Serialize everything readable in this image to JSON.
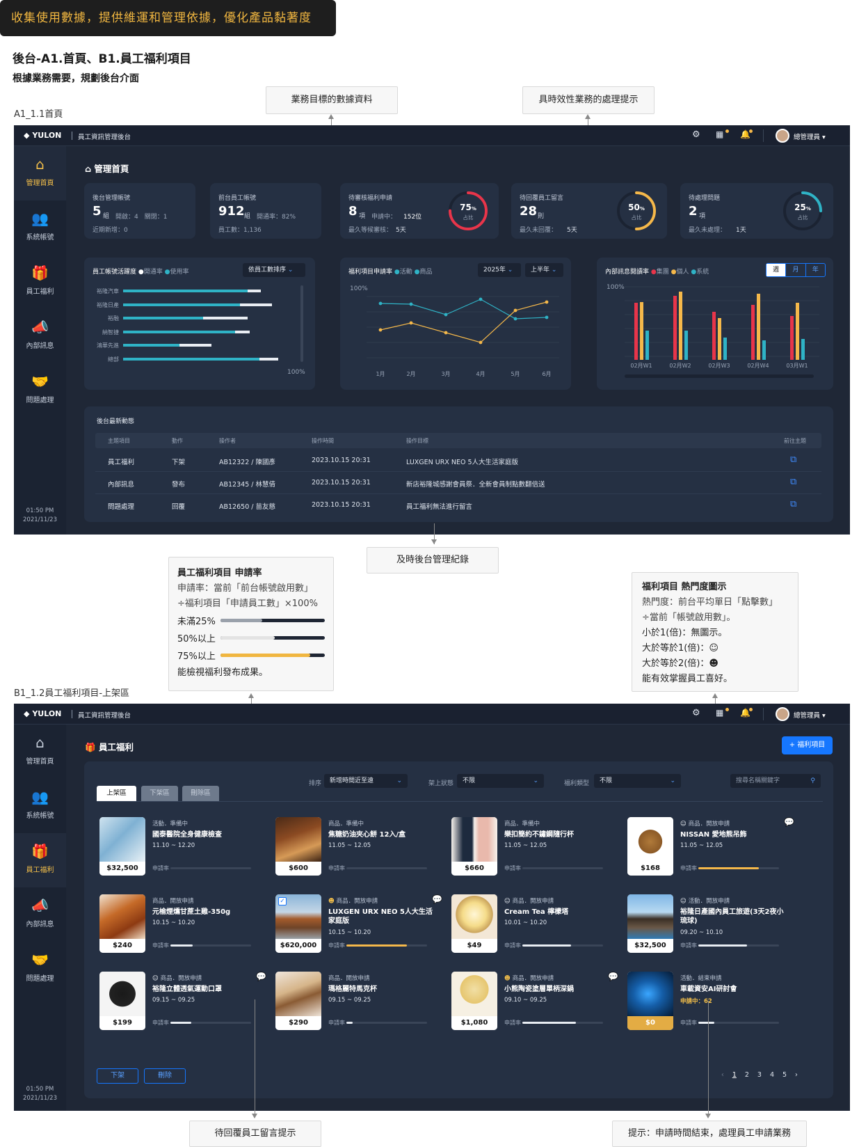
{
  "doc": {
    "banner": "收集使用數據，提供維運和管理依據，優化產品黏著度",
    "title": "後台-A1.首頁、B1.員工福利項目",
    "subtitle": "根據業務需要，規劃後台介面",
    "label_a1": "A1_1.1首頁",
    "label_b1": "B1_1.2員工福利項目-上架區",
    "callouts": {
      "biz_data": "業務目標的數據資料",
      "realtime": "具時效性業務的處理提示",
      "records": "及時後台管理紀錄",
      "reply": "待回覆員工留言提示",
      "hint_end": "提示：申請時間結束，處理員工申請業務"
    },
    "note_rate": {
      "title": "員工福利項目 申請率",
      "l1": "申請率：當前「前台帳號啟用數」",
      "l2": "÷福利項目「申請員工數」×100%",
      "r1": "未滿25%",
      "r2": "50%以上",
      "r3": "75%以上",
      "footer": "能檢視福利發布成果。",
      "c1": "#9aa1ab",
      "c2": "#e3e3e3",
      "c3": "#f0b640"
    },
    "note_hot": {
      "title": "福利項目 熱門度圖示",
      "l1": "熱門度：前台平均單日「點擊數」",
      "l2": "÷當前「帳號啟用數」。",
      "l3": "小於1(倍)：無圖示。",
      "l4": "大於等於1(倍)：",
      "l5": "大於等於2(倍)：",
      "footer": "能有效掌握員工喜好。"
    }
  },
  "app": {
    "logo": "YULON",
    "system": "員工資訊管理後台",
    "user": "總管理員",
    "time": "01:50 PM",
    "date": "2021/11/23",
    "nav": [
      {
        "label": "管理首頁",
        "icon": "home-icon",
        "glyph": "⌂"
      },
      {
        "label": "系統帳號",
        "icon": "users-icon",
        "glyph": "👥"
      },
      {
        "label": "員工福利",
        "icon": "gift-icon",
        "glyph": "🎁"
      },
      {
        "label": "內部訊息",
        "icon": "megaphone-icon",
        "glyph": "📣"
      },
      {
        "label": "問題處理",
        "icon": "handshake-icon",
        "glyph": "🤝"
      }
    ]
  },
  "a1": {
    "page_title": "管理首頁",
    "stats": [
      {
        "title": "後台管理帳號",
        "value": "5",
        "unit": "組",
        "extra": "開啟：4　關閉：1",
        "sub": "近期新增：0"
      },
      {
        "title": "前台員工帳號",
        "value": "912",
        "unit": "組",
        "extra": "開通率：82%",
        "sub": "員工數：1,136"
      },
      {
        "title": "待審核福利申請",
        "value": "8",
        "unit": "項",
        "extra": "申請中：",
        "extra2": "152位",
        "sub": "最久等候審核：",
        "sub2": "5天",
        "pct": "75",
        "pct_label": "占比",
        "color": "#e8354a",
        "ratio": 0.75
      },
      {
        "title": "待回覆員工留言",
        "value": "28",
        "unit": "則",
        "extra": "",
        "sub": "最久未回覆：",
        "sub2": "5天",
        "pct": "50",
        "pct_label": "占比",
        "color": "#f5b84a",
        "ratio": 0.5
      },
      {
        "title": "待處理問題",
        "value": "2",
        "unit": "項",
        "extra": "",
        "sub": "最久未處理：",
        "sub2": "1天",
        "pct": "25",
        "pct_label": "占比",
        "color": "#2fb3c6",
        "ratio": 0.25
      }
    ],
    "activity": {
      "title": "員工帳號活躍度",
      "legend1": "開通率",
      "legend2": "使用率",
      "sort": "依員工數排序",
      "rows": [
        "裕隆汽車",
        "裕隆日產",
        "裕融",
        "納智捷",
        "鴻華先進",
        "總部"
      ],
      "teal": [
        0.78,
        0.73,
        0.5,
        0.7,
        0.35,
        0.85
      ],
      "white": [
        0.08,
        0.2,
        0.28,
        0.09,
        0.2,
        0.12
      ],
      "axis": "100%"
    },
    "line": {
      "title": "福利項目申請率",
      "legend1": "活動",
      "legend2": "商品",
      "year": "2025年",
      "half": "上半年",
      "ylabel": "100%",
      "x": [
        "1月",
        "2月",
        "3月",
        "4月",
        "5月",
        "6月"
      ]
    },
    "bars": {
      "title": "內部訊息閱讀率",
      "legend1": "集團",
      "legend2": "個人",
      "legend3": "系統",
      "tabs": [
        "週",
        "月",
        "年"
      ],
      "ylabel": "100%",
      "x": [
        "02月W1",
        "02月W2",
        "02月W3",
        "02月W4",
        "03月W1"
      ]
    },
    "recent": {
      "title": "後台最新動態",
      "headers": [
        "主題項目",
        "動作",
        "操作者",
        "操作時間",
        "操作目標",
        "前往主題"
      ],
      "rows": [
        [
          "員工福利",
          "下架",
          "AB12322 / 陳國彥",
          "2023.10.15 20:31",
          "LUXGEN URX NEO 5人大生活家庭版"
        ],
        [
          "內部訊息",
          "發布",
          "AB12345 / 林慧倩",
          "2023.10.15 20:31",
          "新店裕隆城感謝會員祭．全新會員制點數翻倍送"
        ],
        [
          "問題處理",
          "回覆",
          "AB12650 / 苗友慈",
          "2023.10.15 20:31",
          "員工福利無法進行留言"
        ]
      ]
    }
  },
  "b1": {
    "page_title": "員工福利",
    "add_btn": "福利項目",
    "tabs": [
      "上架區",
      "下架區",
      "刪除區"
    ],
    "f_sort_label": "排序",
    "f_sort": "新增時間近至遠",
    "f_state_label": "架上狀態",
    "f_state": "不限",
    "f_type_label": "福利類型",
    "f_type": "不限",
    "search_ph": "搜尋名稱關鍵字",
    "rate_label": "申請率",
    "btn_off": "下架",
    "btn_del": "刪除",
    "pages": [
      "1",
      "2",
      "3",
      "4",
      "5"
    ],
    "products": [
      {
        "status": "活動．準備中",
        "name": "國泰醫院全身健康檢查",
        "date": "11.10 ~ 12.20",
        "price": "$32,500",
        "rate": 0,
        "hot": 0,
        "msg": false,
        "img": "doctor"
      },
      {
        "status": "商品．準備中",
        "name": "焦糖奶油夾心餅 12入/盒",
        "date": "11.05 ~ 12.05",
        "price": "$600",
        "rate": 0,
        "hot": 0,
        "msg": false,
        "img": "cookies"
      },
      {
        "status": "商品．準備中",
        "name": "樂扣簡約不鏽鋼隨行杯",
        "date": "11.05 ~ 12.05",
        "price": "$660",
        "rate": 0,
        "hot": 0,
        "msg": false,
        "img": "cups"
      },
      {
        "status": "商品．開放申請",
        "name": "NISSAN 愛地熊吊飾",
        "date": "11.05 ~ 12.05",
        "price": "$168",
        "rate": 0.75,
        "hot": 1,
        "msg": true,
        "img": "bear"
      },
      {
        "status": "商品．開放申請",
        "name": "元榆煙燻甘蔗土雞-350g",
        "date": "10.15 ~ 10.20",
        "price": "$240",
        "rate": 0.28,
        "hot": 0,
        "msg": false,
        "img": "chicken"
      },
      {
        "status": "商品．開放申請",
        "name": "LUXGEN URX NEO 5人大生活家庭版",
        "date": "10.15 ~ 10.20",
        "price": "$620,000",
        "rate": 0.75,
        "hot": 2,
        "msg": true,
        "img": "car"
      },
      {
        "status": "商品．開放申請",
        "name": "Cream Tea 檸檬塔",
        "date": "10.01 ~ 10.20",
        "price": "$49",
        "rate": 0.6,
        "hot": 1,
        "msg": false,
        "img": "tart"
      },
      {
        "status": "活動．開放申請",
        "name": "裕隆日產國內員工旅遊(3天2夜小琉球)",
        "date": "09.20 ~ 10.10",
        "price": "$32,500",
        "rate": 0.6,
        "hot": 1,
        "msg": false,
        "img": "rock"
      },
      {
        "status": "商品．開放申請",
        "name": "裕隆立體透氣運動口罩",
        "date": "09.15 ~ 09.25",
        "price": "$199",
        "rate": 0.26,
        "hot": 1,
        "msg": true,
        "img": "mask"
      },
      {
        "status": "商品．開放申請",
        "name": "瑪格麗特馬克杯",
        "date": "09.15 ~ 09.25",
        "price": "$290",
        "rate": 0.08,
        "hot": 0,
        "msg": false,
        "img": "mugs"
      },
      {
        "status": "商品．開放申請",
        "name": "小熊陶瓷塗層單柄深鍋",
        "date": "09.10 ~ 09.25",
        "price": "$1,080",
        "rate": 0.66,
        "hot": 2,
        "msg": true,
        "img": "pot"
      },
      {
        "status": "活動．結束申請",
        "name": "車載資安AI研討會",
        "date": "申請中：62",
        "price": "$0",
        "rate": 0.2,
        "hot": 0,
        "msg": false,
        "img": "ai",
        "ended": true
      }
    ]
  },
  "colors": {
    "accent": "#f5c04a",
    "teal": "#2fb3c6",
    "red": "#e8354a",
    "orange": "#f5b84a",
    "blue": "#1677ff"
  }
}
